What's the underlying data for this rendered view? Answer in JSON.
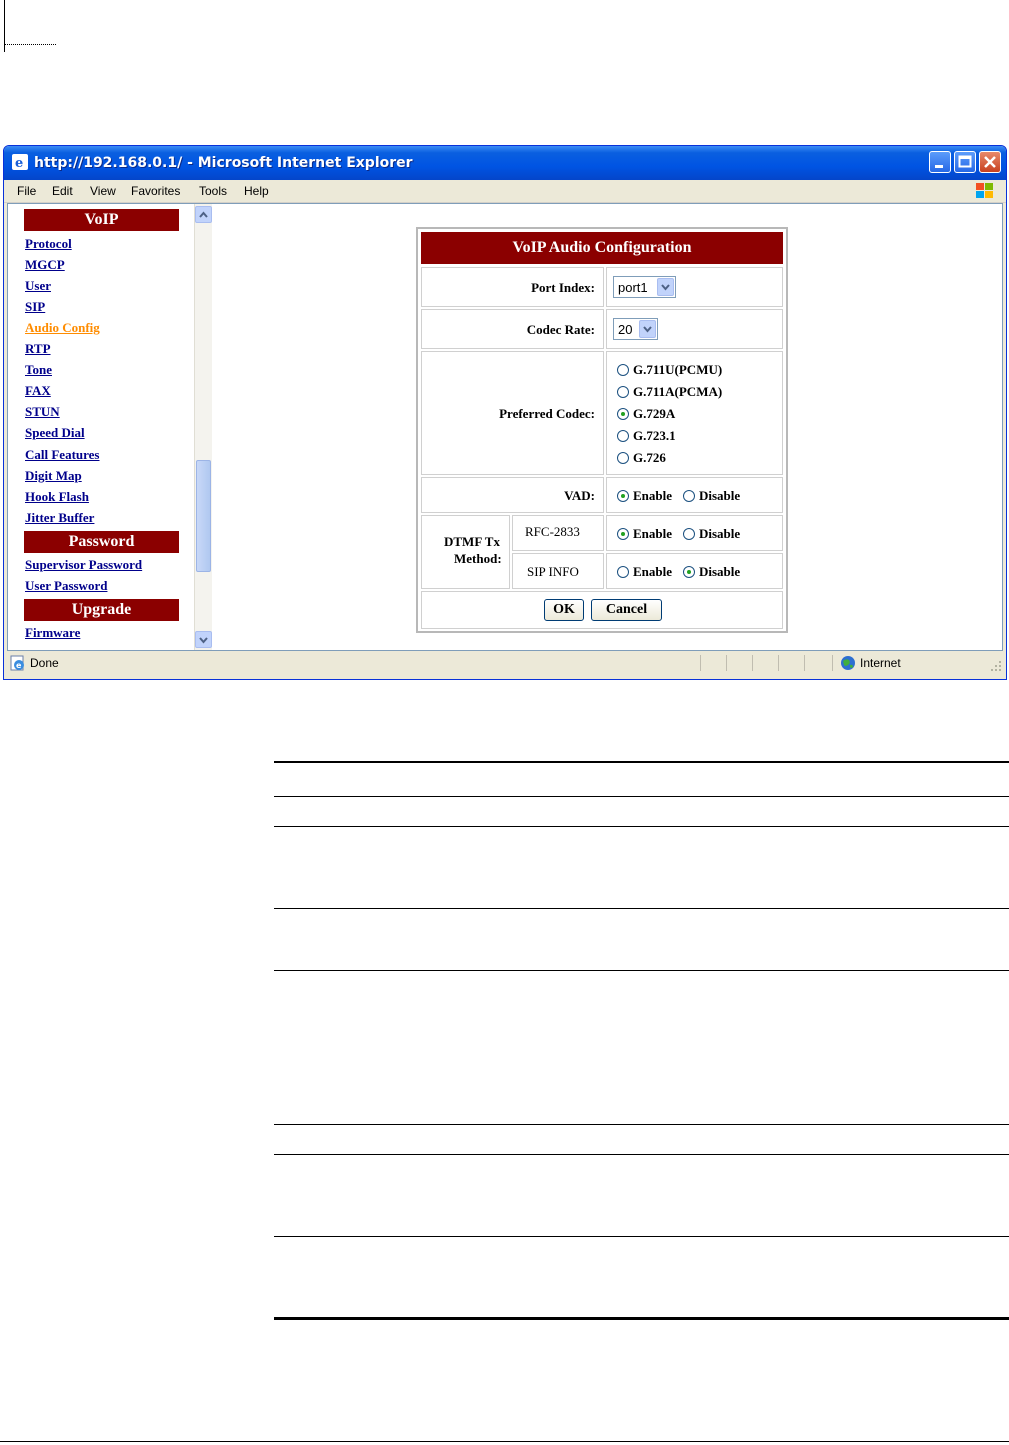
{
  "window": {
    "title": "http://192.168.0.1/ - Microsoft Internet Explorer"
  },
  "menubar": {
    "items": [
      "File",
      "Edit",
      "View",
      "Favorites",
      "Tools",
      "Help"
    ]
  },
  "nav": {
    "sections": [
      {
        "header": "VoIP",
        "links": [
          "Protocol",
          "MGCP",
          "User",
          "SIP",
          "Audio Config",
          "RTP",
          "Tone",
          "FAX",
          "STUN",
          "Speed Dial",
          "Call Features",
          "Digit Map",
          "Hook Flash",
          "Jitter Buffer"
        ]
      },
      {
        "header": "Password",
        "links": [
          "Supervisor Password",
          "User Password"
        ]
      },
      {
        "header": "Upgrade",
        "links": [
          "Firmware"
        ]
      }
    ],
    "active_link": "Audio Config"
  },
  "panel": {
    "title": "VoIP Audio Configuration",
    "port_index_label": "Port Index:",
    "port_index_value": "port1",
    "codec_rate_label": "Codec Rate:",
    "codec_rate_value": "20",
    "preferred_codec_label": "Preferred Codec:",
    "codecs": [
      {
        "label": "G.711U(PCMU)",
        "selected": false
      },
      {
        "label": "G.711A(PCMA)",
        "selected": false
      },
      {
        "label": "G.729A",
        "selected": true
      },
      {
        "label": "G.723.1",
        "selected": false
      },
      {
        "label": "G.726",
        "selected": false
      }
    ],
    "vad_label": "VAD:",
    "vad_value": "Enable",
    "dtmf_label_line1": "DTMF Tx",
    "dtmf_label_line2": "Method:",
    "rfc_label": "RFC-2833",
    "rfc_value": "Enable",
    "sipinfo_label": "SIP INFO",
    "sipinfo_value": "Disable",
    "enable_label": "Enable",
    "disable_label": "Disable",
    "ok_label": "OK",
    "cancel_label": "Cancel"
  },
  "statusbar": {
    "status_text": "Done",
    "zone_text": "Internet"
  }
}
